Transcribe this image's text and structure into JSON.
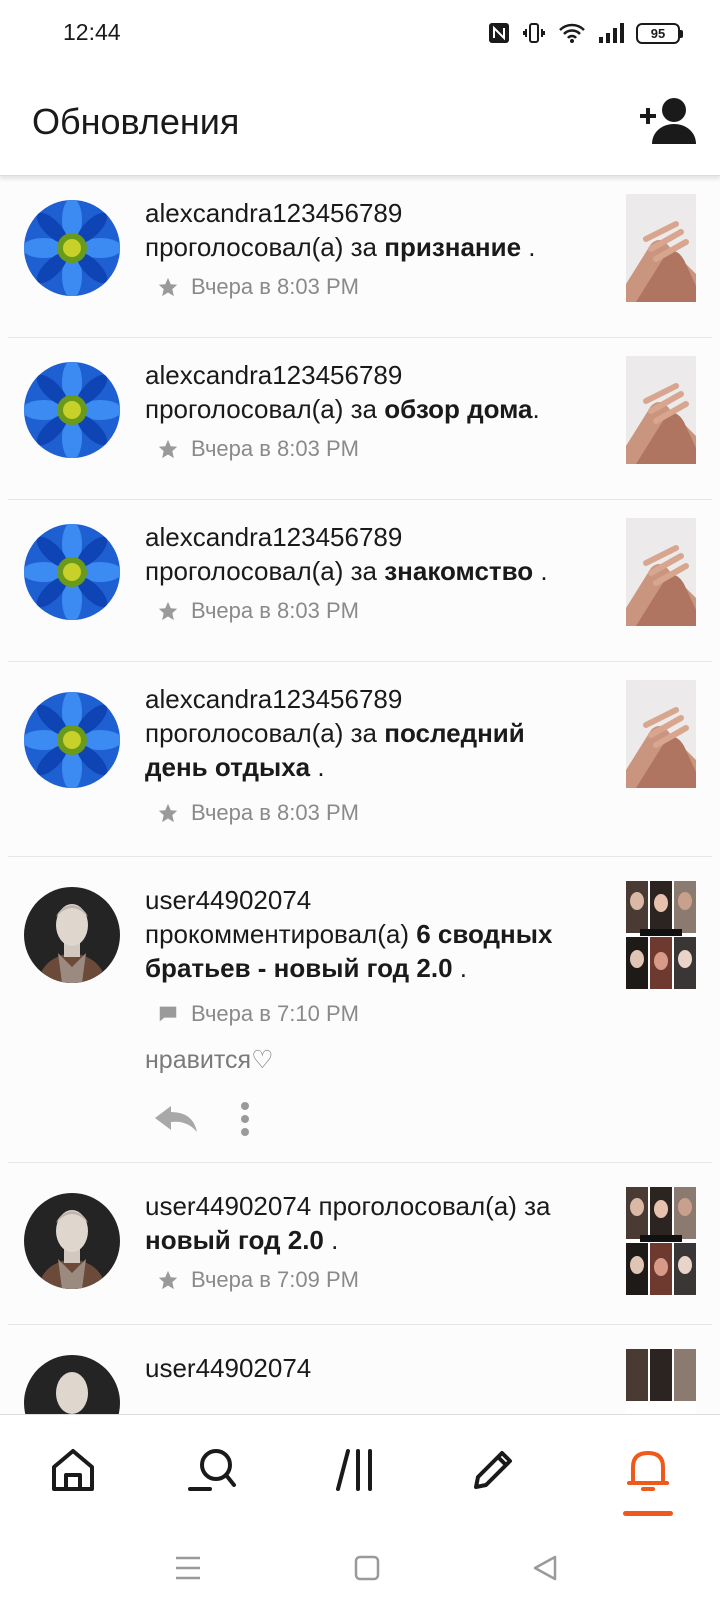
{
  "status_bar": {
    "time": "12:44",
    "battery": "95"
  },
  "header": {
    "title": "Обновления",
    "add_friend_icon": "add-person-icon"
  },
  "feed": [
    {
      "user": "alexcandra123456789",
      "action": "проголосовал(а) за",
      "target": "признание",
      "suffix": " .",
      "time": "Вчера в 8:03 PM",
      "meta_icon": "star-icon",
      "avatar": "blue-flower",
      "thumb": "hands"
    },
    {
      "user": "alexcandra123456789",
      "action": "проголосовал(а) за",
      "target": "обзор дома",
      "suffix": ".",
      "time": "Вчера в 8:03 PM",
      "meta_icon": "star-icon",
      "avatar": "blue-flower",
      "thumb": "hands"
    },
    {
      "user": "alexcandra123456789",
      "action": "проголосовал(а) за",
      "target": "знакомство",
      "suffix": " .",
      "time": "Вчера в 8:03 PM",
      "meta_icon": "star-icon",
      "avatar": "blue-flower",
      "thumb": "hands"
    },
    {
      "user": "alexcandra123456789",
      "action": "проголосовал(а) за",
      "target_line1": "последний",
      "target_line2": "день отдыха",
      "suffix": " .",
      "time": "Вчера в 8:03 PM",
      "meta_icon": "star-icon",
      "avatar": "blue-flower",
      "thumb": "hands"
    },
    {
      "user": "user44902074",
      "action": "прокомментировал(а)",
      "target_line1": "6 сводных",
      "target_line2": "братьев - новый год 2.0",
      "suffix": " .",
      "time": "Вчера в 7:10 PM",
      "meta_icon": "comment-icon",
      "comment": "нравится♡",
      "avatar": "person",
      "thumb": "collage"
    },
    {
      "user": "user44902074",
      "action": "проголосовал(а) за",
      "target": "новый год 2.0",
      "suffix": " .",
      "time": "Вчера в 7:09 PM",
      "meta_icon": "star-icon",
      "avatar": "person",
      "thumb": "collage"
    },
    {
      "user": "user44902074",
      "avatar": "person",
      "thumb": "collage"
    }
  ],
  "bottom_nav": {
    "items": [
      "home-icon",
      "search-icon",
      "library-icon",
      "write-icon",
      "notifications-icon"
    ],
    "active": "notifications-icon",
    "accent": "#ee5a1b"
  },
  "system_nav": [
    "menu-icon",
    "home-square-icon",
    "back-triangle-icon"
  ]
}
